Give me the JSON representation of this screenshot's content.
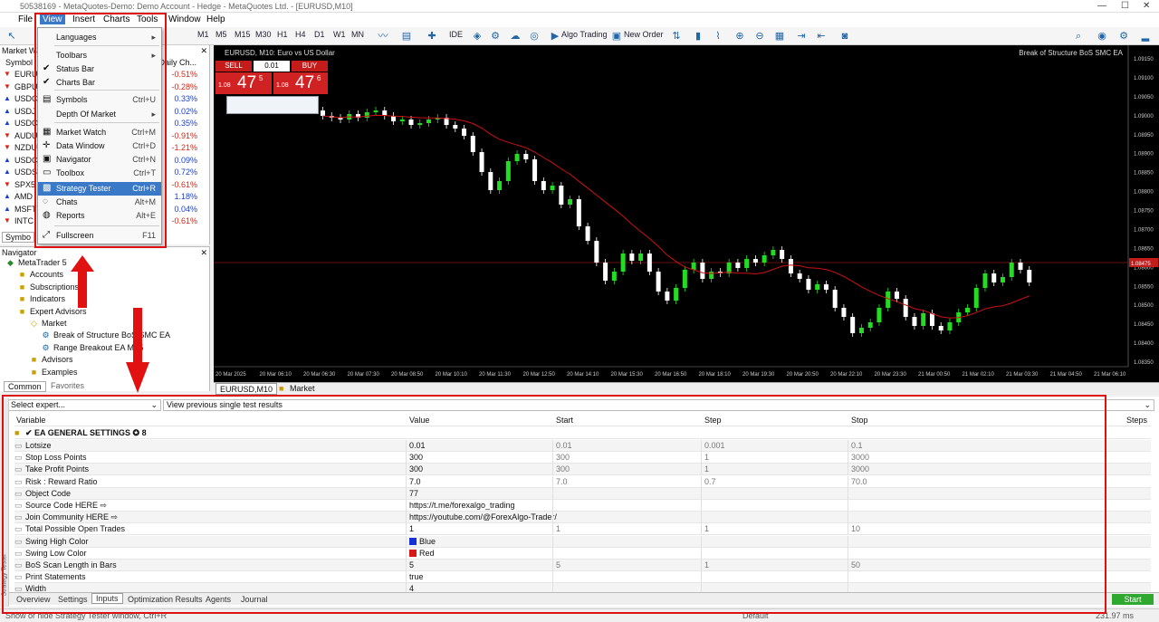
{
  "window": {
    "title": "50538169 - MetaQuotes-Demo: Demo Account - Hedge - MetaQuotes Ltd. - [EURUSD,M10]",
    "minimize": "—",
    "maximize": "☐",
    "close": "✕"
  },
  "menu": [
    "File",
    "View",
    "Insert",
    "Charts",
    "Tools",
    "Window",
    "Help"
  ],
  "toolbar": {
    "timeframes": [
      "M1",
      "M5",
      "M15",
      "M30",
      "H1",
      "H4",
      "D1",
      "W1",
      "MN"
    ],
    "ide": "IDE",
    "algo_trading": "Algo Trading",
    "new_order": "New Order"
  },
  "view_menu": {
    "items": [
      {
        "label": "Languages",
        "shortcut": "▸",
        "icon": ""
      },
      {
        "label": "Toolbars",
        "shortcut": "▸",
        "icon": ""
      },
      {
        "label": "Status Bar",
        "shortcut": "",
        "icon": "✔"
      },
      {
        "label": "Charts Bar",
        "shortcut": "",
        "icon": "✔"
      },
      {
        "label": "Symbols",
        "shortcut": "Ctrl+U",
        "icon": "▤"
      },
      {
        "label": "Depth Of Market",
        "shortcut": "▸",
        "icon": ""
      },
      {
        "label": "Market Watch",
        "shortcut": "Ctrl+M",
        "icon": "▦"
      },
      {
        "label": "Data Window",
        "shortcut": "Ctrl+D",
        "icon": "✛"
      },
      {
        "label": "Navigator",
        "shortcut": "Ctrl+N",
        "icon": "▣"
      },
      {
        "label": "Toolbox",
        "shortcut": "Ctrl+T",
        "icon": "▭"
      },
      {
        "label": "Strategy Tester",
        "shortcut": "Ctrl+R",
        "icon": "▩"
      },
      {
        "label": "Chats",
        "shortcut": "Alt+M",
        "icon": "◌"
      },
      {
        "label": "Reports",
        "shortcut": "Alt+E",
        "icon": "◍"
      },
      {
        "label": "Fullscreen",
        "shortcut": "F11",
        "icon": "⤢"
      }
    ]
  },
  "market_watch": {
    "title": "Market Wat",
    "col_symbol": "Symbol",
    "col_change": "Daily Ch...",
    "rows": [
      {
        "symbol": "EURU",
        "change": "-0.51%",
        "dir": "down"
      },
      {
        "symbol": "GBPU",
        "change": "-0.28%",
        "dir": "down"
      },
      {
        "symbol": "USDC",
        "change": "0.33%",
        "dir": "up"
      },
      {
        "symbol": "USDJ",
        "change": "0.02%",
        "dir": "up"
      },
      {
        "symbol": "USDC",
        "change": "0.35%",
        "dir": "up"
      },
      {
        "symbol": "AUDU",
        "change": "-0.91%",
        "dir": "down"
      },
      {
        "symbol": "NZDU",
        "change": "-1.21%",
        "dir": "down"
      },
      {
        "symbol": "USDC",
        "change": "0.09%",
        "dir": "up"
      },
      {
        "symbol": "USDS",
        "change": "0.72%",
        "dir": "up"
      },
      {
        "symbol": "SPX5",
        "change": "-0.61%",
        "dir": "down"
      },
      {
        "symbol": "AMD",
        "change": "1.18%",
        "dir": "up"
      },
      {
        "symbol": "MSFT",
        "change": "0.04%",
        "dir": "up"
      },
      {
        "symbol": "INTC",
        "change": "-0.61%",
        "dir": "down"
      }
    ],
    "tab": "Symbo"
  },
  "navigator": {
    "title": "Navigator",
    "items": [
      {
        "label": "MetaTrader 5",
        "indent": 0
      },
      {
        "label": "Accounts",
        "indent": 1
      },
      {
        "label": "Subscriptions",
        "indent": 1
      },
      {
        "label": "Indicators",
        "indent": 1
      },
      {
        "label": "Expert Advisors",
        "indent": 1
      },
      {
        "label": "Market",
        "indent": 2
      },
      {
        "label": "Break of Structure BoS SMC EA",
        "indent": 3
      },
      {
        "label": "Range Breakout EA MT5",
        "indent": 3
      },
      {
        "label": "Advisors",
        "indent": 2
      },
      {
        "label": "Examples",
        "indent": 2
      }
    ],
    "tabs": [
      "Common",
      "Favorites"
    ]
  },
  "chart": {
    "symbol_label": "EURUSD, M10: Euro vs US Dollar",
    "ea_label": "Break of Structure BoS SMC EA",
    "sell": "SELL",
    "buy": "BUY",
    "lot": "0.01",
    "sell_price_prefix": "1.08",
    "sell_price": "47",
    "sell_sup": "5",
    "buy_price_prefix": "1.08",
    "buy_price": "47",
    "buy_sup": "6",
    "price_labels": [
      "1.09150",
      "1.09100",
      "1.09050",
      "1.09000",
      "1.08950",
      "1.08900",
      "1.08850",
      "1.08800",
      "1.08750",
      "1.08700",
      "1.08650",
      "1.08600",
      "1.08550",
      "1.08500",
      "1.08450",
      "1.08400",
      "1.08350"
    ],
    "current_price": "1.08475",
    "time_labels": [
      "20 Mar 2025",
      "20 Mar 06:10",
      "20 Mar 06:30",
      "20 Mar 07:30",
      "20 Mar 08:50",
      "20 Mar 10:10",
      "20 Mar 11:30",
      "20 Mar 12:50",
      "20 Mar 14:10",
      "20 Mar 15:30",
      "20 Mar 16:50",
      "20 Mar 18:10",
      "20 Mar 19:30",
      "20 Mar 20:50",
      "20 Mar 22:10",
      "20 Mar 23:30",
      "21 Mar 00:50",
      "21 Mar 02:10",
      "21 Mar 03:30",
      "21 Mar 04:50",
      "21 Mar 06:10"
    ],
    "tabs": [
      "EURUSD,M10",
      "Market"
    ]
  },
  "tester": {
    "select_expert": "Select expert...",
    "view_previous": "View previous single test results",
    "columns": [
      "Variable",
      "Value",
      "Start",
      "Step",
      "Stop",
      "Steps"
    ],
    "section": "EA GENERAL SETTINGS ✪ 8",
    "rows": [
      {
        "name": "Lotsize",
        "value": "0.01",
        "start": "0.01",
        "step": "0.001",
        "stop": "0.1"
      },
      {
        "name": "Stop Loss Points",
        "value": "300",
        "start": "300",
        "step": "1",
        "stop": "3000"
      },
      {
        "name": "Take Profit Points",
        "value": "300",
        "start": "300",
        "step": "1",
        "stop": "3000"
      },
      {
        "name": "Risk : Reward Ratio",
        "value": "7.0",
        "start": "7.0",
        "step": "0.7",
        "stop": "70.0"
      },
      {
        "name": "Object Code",
        "value": "77",
        "start": "",
        "step": "",
        "stop": ""
      },
      {
        "name": "Source Code HERE ⇨",
        "value": "https://t.me/forexalgo_trading",
        "start": "",
        "step": "",
        "stop": ""
      },
      {
        "name": "Join Community HERE ⇨",
        "value": "https://youtube.com/@ForexAlgo-Trader/",
        "start": "",
        "step": "",
        "stop": ""
      },
      {
        "name": "Total Possible Open Trades",
        "value": "1",
        "start": "1",
        "step": "1",
        "stop": "10"
      },
      {
        "name": "Swing High Color",
        "value": "Blue",
        "start": "",
        "step": "",
        "stop": "",
        "swatch": "#1830d8"
      },
      {
        "name": "Swing Low Color",
        "value": "Red",
        "start": "",
        "step": "",
        "stop": "",
        "swatch": "#d81818"
      },
      {
        "name": "BoS Scan Length in Bars",
        "value": "5",
        "start": "5",
        "step": "1",
        "stop": "50"
      },
      {
        "name": "Print Statements",
        "value": "true",
        "start": "",
        "step": "",
        "stop": ""
      },
      {
        "name": "Width",
        "value": "4",
        "start": "",
        "step": "",
        "stop": ""
      }
    ],
    "tabs": [
      "Overview",
      "Settings",
      "Inputs",
      "Optimization Results",
      "Agents",
      "Journal"
    ],
    "start_button": "Start",
    "side_label": "Strategy Tester"
  },
  "status": {
    "left": "Show or hide Strategy Tester window, Ctrl+R",
    "middle": "Default",
    "right": "231.97 ms"
  },
  "colors": {
    "accent": "#d11111",
    "bull": "#22dd22",
    "bear": "#ffffff",
    "ma": "#cc1111",
    "select": "#3a78c8"
  }
}
